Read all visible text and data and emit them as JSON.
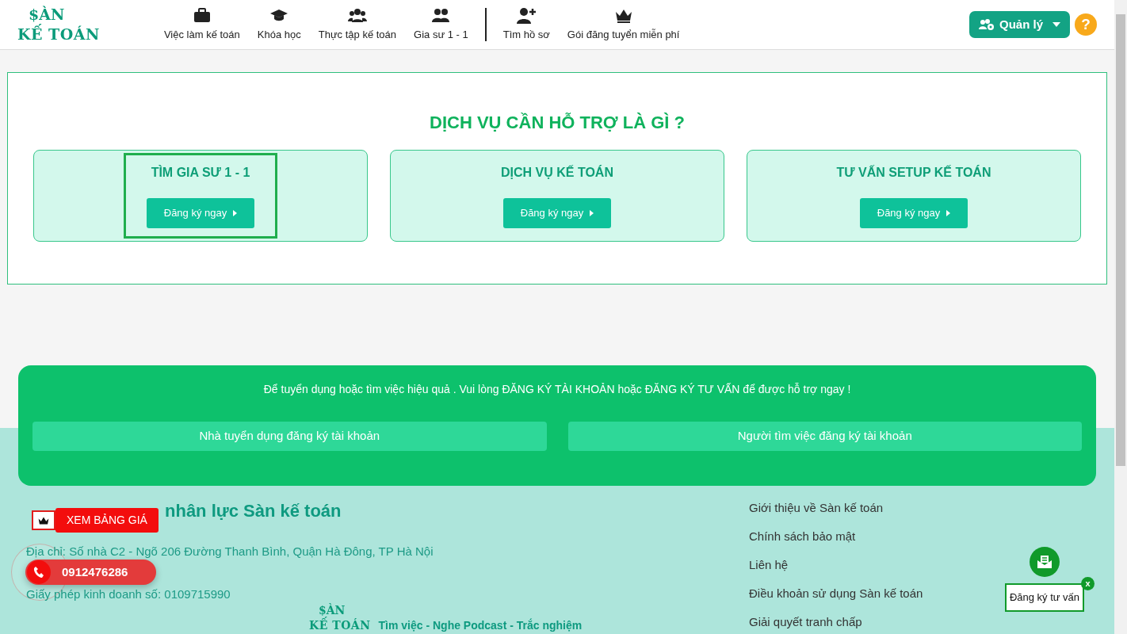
{
  "logo": {
    "line1": "$ÀN",
    "line2": "KẾ TOÁN"
  },
  "nav": [
    {
      "label": "Việc làm kế toán",
      "divider_before": false
    },
    {
      "label": "Khóa học",
      "divider_before": false
    },
    {
      "label": "Thực tập kế toán",
      "divider_before": false
    },
    {
      "label": "Gia sư 1 - 1",
      "divider_before": false
    },
    {
      "label": "Tìm hồ sơ",
      "divider_before": true
    },
    {
      "label": "Gói đăng tuyển miễn phí",
      "divider_before": false
    }
  ],
  "manage_button": {
    "label": "Quản lý"
  },
  "help_button": {
    "label": "?"
  },
  "services": {
    "title": "DỊCH VỤ CẦN HỖ TRỢ LÀ GÌ ?",
    "items": [
      {
        "title": "TÌM GIA SƯ 1 - 1",
        "button": "Đăng ký ngay",
        "highlighted": true
      },
      {
        "title": "DỊCH VỤ KẾ TOÁN",
        "button": "Đăng ký ngay",
        "highlighted": false
      },
      {
        "title": "TƯ VẤN SETUP KẾ TOÁN",
        "button": "Đăng ký ngay",
        "highlighted": false
      }
    ]
  },
  "cta": {
    "message": "Để tuyển dụng hoặc tìm việc hiệu quả . Vui lòng ĐĂNG KÝ TÀI KHOẢN hoặc ĐĂNG KÝ TƯ VẤN để được hỗ trợ ngay !",
    "buttons": [
      "Nhà tuyển dụng đăng ký tài khoản",
      "Người tìm việc đăng ký tài khoản"
    ]
  },
  "footer": {
    "company": "nhân lực Sàn kế toán",
    "lines": [
      "Địa chỉ: Số nhà C2 - Ngõ 206 Đường Thanh Bình, Quận Hà Đông, TP Hà Nội",
      "Giấy phép kinh doanh số: 0109715990"
    ],
    "logo": {
      "line1": "$ÀN",
      "line2": "KẾ TOÁN"
    },
    "tagline": "Tìm việc - Nghe Podcast - Trắc nghiệm",
    "links": [
      "Giới thiệu về Sàn kế toán",
      "Chính sách bảo mật",
      "Liên hệ",
      "Điều khoản sử dụng Sàn kế toán",
      "Giải quyết tranh chấp"
    ]
  },
  "floating": {
    "price_button": "XEM BẢNG GIÁ",
    "phone": "0912476286",
    "consult": "Đăng ký tư vấn",
    "consult_close": "x"
  }
}
